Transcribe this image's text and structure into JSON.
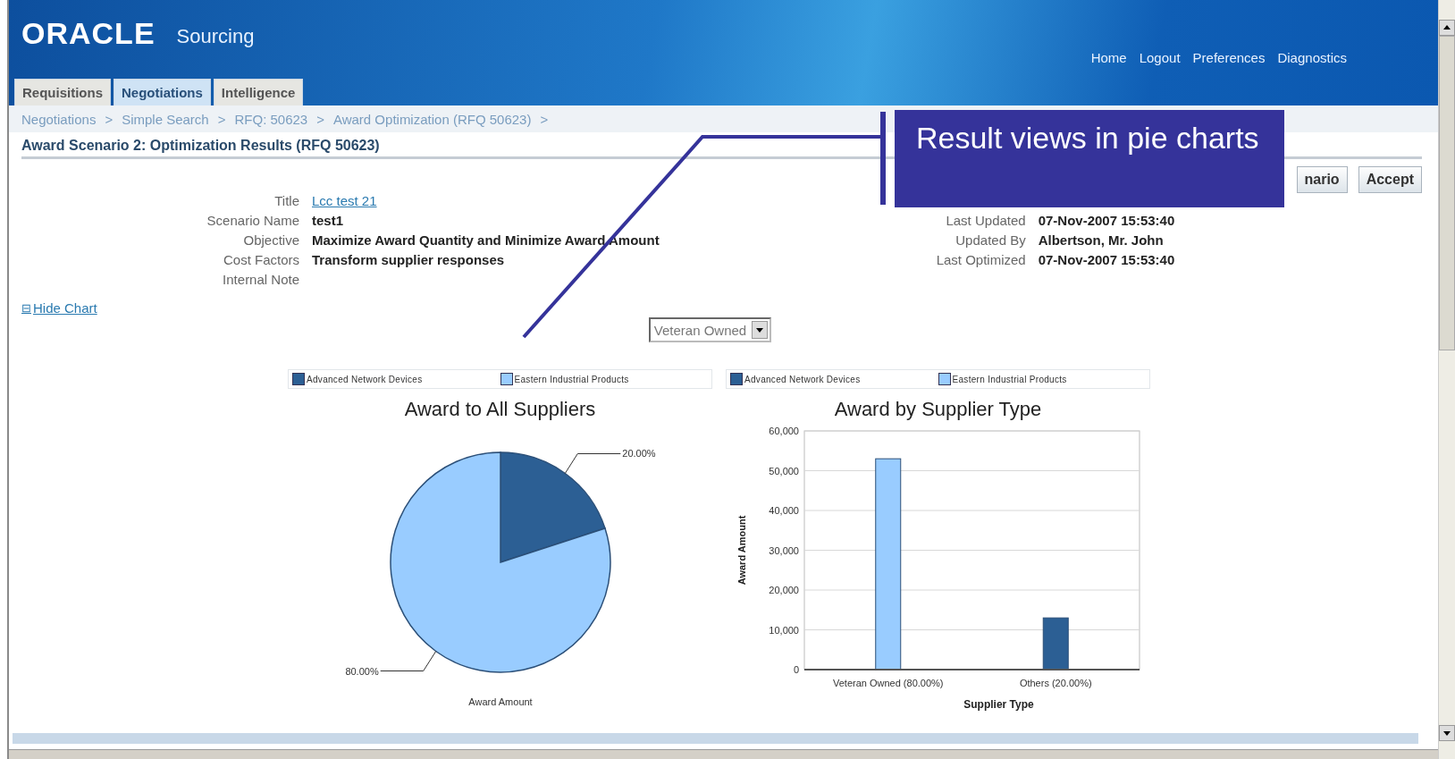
{
  "header": {
    "logo": "ORACLE",
    "product": "Sourcing",
    "global_links": [
      "Home",
      "Logout",
      "Preferences",
      "Diagnostics"
    ]
  },
  "tabs": [
    {
      "label": "Requisitions",
      "selected": false
    },
    {
      "label": "Negotiations",
      "selected": true
    },
    {
      "label": "Intelligence",
      "selected": false
    }
  ],
  "breadcrumbs": [
    "Negotiations",
    "Simple Search",
    "RFQ: 50623",
    "Award Optimization (RFQ 50623)"
  ],
  "breadcrumb_separator": ">",
  "page_title": "Award Scenario 2: Optimization Results (RFQ 50623)",
  "buttons": [
    "nario",
    "Accept"
  ],
  "details_left": [
    {
      "label": "Title",
      "value": "Lcc test 21",
      "kind": "link"
    },
    {
      "label": "Scenario Name",
      "value": "test1",
      "kind": "text"
    },
    {
      "label": "Objective",
      "value": "Maximize Award Quantity and Minimize Award Amount",
      "kind": "text"
    },
    {
      "label": "Cost Factors",
      "value": "Transform supplier responses",
      "kind": "text"
    },
    {
      "label": "Internal Note",
      "kind": "text"
    }
  ],
  "details_right": [
    {
      "label": "Last Updated",
      "value": "07-Nov-2007 15:53:40"
    },
    {
      "label": "Updated By",
      "value": "Albertson, Mr. John"
    },
    {
      "label": "Last Optimized",
      "value": "07-Nov-2007 15:53:40"
    }
  ],
  "hide_chart": {
    "icon": "⊟",
    "label": "Hide Chart"
  },
  "supplier_type_select": {
    "value": "Veteran Owned"
  },
  "charts": [
    {
      "chart_data": {
        "type": "pie",
        "title": "Award to All Suppliers",
        "xlabel": "Award Amount",
        "legend": true,
        "categories": [
          "Advanced Network Devices",
          "Eastern Industrial Products"
        ],
        "values": [
          20,
          80
        ],
        "value_labels": [
          "20.00%",
          "80.00%"
        ]
      }
    },
    {
      "chart_data": {
        "type": "bar",
        "title": "Award by Supplier Type",
        "xlabel": "Supplier Type",
        "ylabel": "Award Amount",
        "categories": [
          "Veteran Owned (80.00%)",
          "Others (20.00%)"
        ],
        "series": [
          {
            "name": "Advanced Network Devices",
            "color": "#2c5f94",
            "values": [
              null,
              13000
            ]
          },
          {
            "name": "Eastern Industrial Products",
            "color": "#99ccff",
            "values": [
              53000,
              null
            ]
          }
        ],
        "ylim": [
          0,
          60000
        ],
        "grid": true,
        "legend": true,
        "yticks": [
          {
            "value": 0,
            "label": "0"
          },
          {
            "value": 10000,
            "label": "10,000"
          },
          {
            "value": 20000,
            "label": "20,000"
          },
          {
            "value": 30000,
            "label": "30,000"
          },
          {
            "value": 40000,
            "label": "40,000"
          },
          {
            "value": 50000,
            "label": "50,000"
          },
          {
            "value": 60000,
            "label": "60,000"
          }
        ]
      }
    }
  ],
  "callout": {
    "text": "Result views in pie charts"
  }
}
